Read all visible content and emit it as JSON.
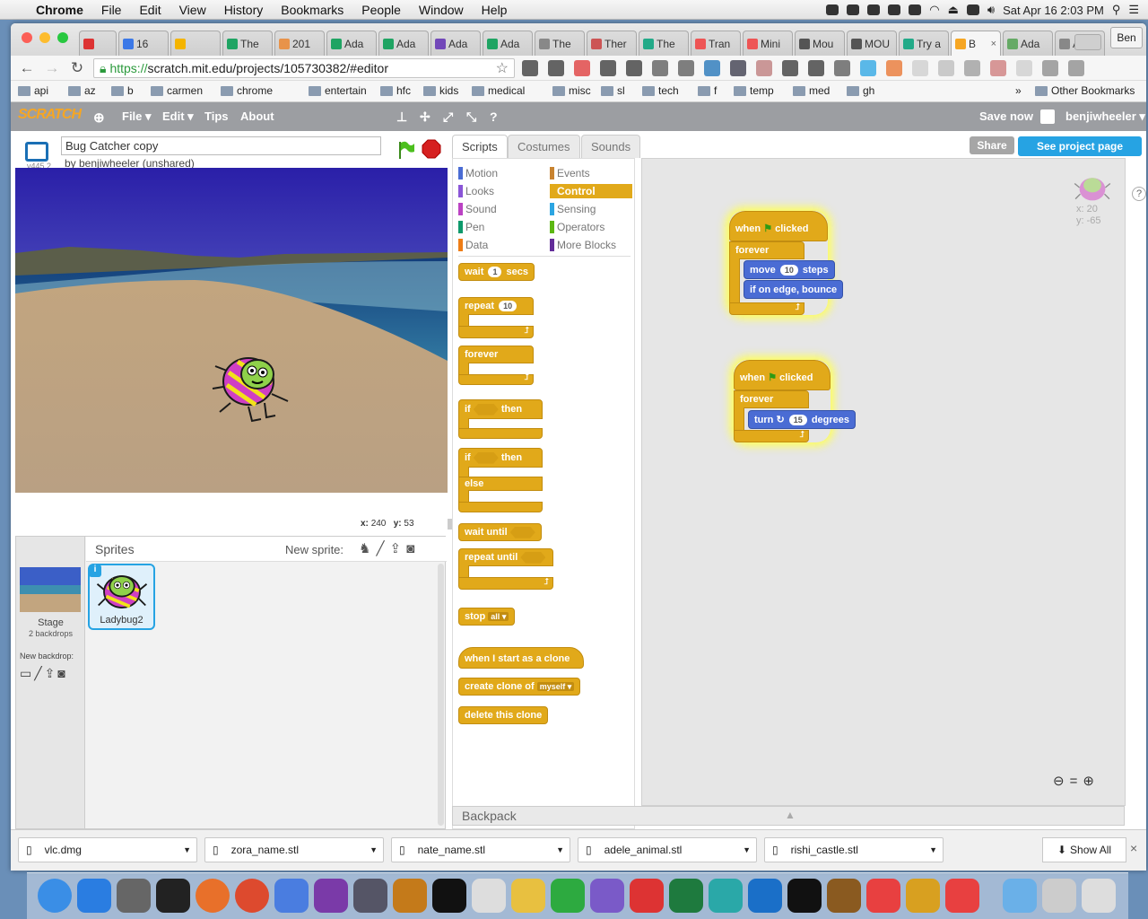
{
  "menubar": {
    "app": "Chrome",
    "items": [
      "File",
      "Edit",
      "View",
      "History",
      "Bookmarks",
      "People",
      "Window",
      "Help"
    ],
    "clock": "Sat Apr 16  2:03 PM"
  },
  "browser": {
    "tabs": [
      {
        "label": "",
        "icon": "gmail-icon",
        "color": "#d33"
      },
      {
        "label": "16",
        "icon": "calendar-icon",
        "color": "#3b78e7"
      },
      {
        "label": "",
        "icon": "drive-icon",
        "color": "#f4b400"
      },
      {
        "label": "The",
        "icon": "sheets-icon",
        "color": "#1fa463"
      },
      {
        "label": "201",
        "icon": "e-icon",
        "color": "#e8934a"
      },
      {
        "label": "Ada",
        "icon": "sheets-icon",
        "color": "#1fa463"
      },
      {
        "label": "Ada",
        "icon": "sheets-icon",
        "color": "#1fa463"
      },
      {
        "label": "Ada",
        "icon": "forms-icon",
        "color": "#7248b9"
      },
      {
        "label": "Ada",
        "icon": "sheets-icon",
        "color": "#1fa463"
      },
      {
        "label": "The",
        "icon": "page-icon",
        "color": "#888"
      },
      {
        "label": "Ther",
        "icon": "tree-icon",
        "color": "#c55"
      },
      {
        "label": "The",
        "icon": "medium-icon",
        "color": "#2a8"
      },
      {
        "label": "Tran",
        "icon": "pen-icon",
        "color": "#e55"
      },
      {
        "label": "Mini",
        "icon": "pen-icon",
        "color": "#e55"
      },
      {
        "label": "Mou",
        "icon": "page-icon",
        "color": "#555"
      },
      {
        "label": "MOU",
        "icon": "page-icon",
        "color": "#555"
      },
      {
        "label": "Try a",
        "icon": "medium-icon",
        "color": "#2a8"
      },
      {
        "label": "B",
        "icon": "scratch-icon",
        "color": "#f6a623",
        "active": true
      },
      {
        "label": "Ada",
        "icon": "link-icon",
        "color": "#6a6"
      },
      {
        "label": "Ada",
        "icon": "page-icon",
        "color": "#888"
      }
    ],
    "profile": "Ben",
    "url_scheme": "https://",
    "url_rest": "scratch.mit.edu/projects/105730382/#editor"
  },
  "bookmarks": [
    "api",
    "az",
    "b",
    "carmen",
    "chrome",
    "entertain",
    "hfc",
    "kids",
    "medical",
    "misc",
    "sl",
    "tech",
    "f",
    "temp",
    "med",
    "gh"
  ],
  "bookmarks_more": "»",
  "other_bookmarks": "Other Bookmarks",
  "scratch": {
    "logo": "SCRATCH",
    "nav": [
      "File ▾",
      "Edit ▾",
      "Tips",
      "About"
    ],
    "save_now": "Save now",
    "username": "benjiwheeler ▾",
    "project_title": "Bug Catcher copy",
    "byline": "by benjiwheeler (unshared)",
    "version": "v445.2",
    "share": "Share",
    "see_project": "See project page",
    "stage_x_label": "x:",
    "stage_x": "240",
    "stage_y_label": "y:",
    "stage_y": "53",
    "sprites_label": "Sprites",
    "new_sprite": "New sprite:",
    "stage_label": "Stage",
    "backdrops": "2 backdrops",
    "new_backdrop": "New backdrop:",
    "sprite_name": "Ladybug2",
    "tabs": [
      "Scripts",
      "Costumes",
      "Sounds"
    ],
    "categories_left": [
      {
        "name": "Motion",
        "color": "#4a6cd4"
      },
      {
        "name": "Looks",
        "color": "#8a55d7"
      },
      {
        "name": "Sound",
        "color": "#bb42c3"
      },
      {
        "name": "Pen",
        "color": "#0e9a6c"
      },
      {
        "name": "Data",
        "color": "#ee7d16"
      }
    ],
    "categories_right": [
      {
        "name": "Events",
        "color": "#c88330"
      },
      {
        "name": "Control",
        "color": "#e1a91a",
        "selected": true
      },
      {
        "name": "Sensing",
        "color": "#2ca5e2"
      },
      {
        "name": "Operators",
        "color": "#5cb712"
      },
      {
        "name": "More Blocks",
        "color": "#632d99"
      }
    ],
    "palette": {
      "wait": "wait",
      "wait_val": "1",
      "wait_unit": "secs",
      "repeat": "repeat",
      "repeat_val": "10",
      "forever": "forever",
      "if": "if",
      "then": "then",
      "if2": "if",
      "then2": "then",
      "else": "else",
      "wait_until": "wait  until",
      "repeat_until": "repeat  until",
      "stop": "stop",
      "stop_opt": "all",
      "clone_start": "when I start as a clone",
      "create_clone": "create clone of",
      "create_clone_opt": "myself",
      "delete_clone": "delete this clone"
    },
    "script1": {
      "when": "when",
      "clicked": "clicked",
      "forever": "forever",
      "move": "move",
      "move_val": "10",
      "steps": "steps",
      "bounce": "if on edge, bounce"
    },
    "script2": {
      "when": "when",
      "clicked": "clicked",
      "forever": "forever",
      "turn": "turn",
      "turn_val": "15",
      "degrees": "degrees"
    },
    "sprite_x": "x: 20",
    "sprite_y": "y: -65",
    "backpack": "Backpack"
  },
  "downloads": [
    "vlc.dmg",
    "zora_name.stl",
    "nate_name.stl",
    "adele_animal.stl",
    "rishi_castle.stl"
  ],
  "show_all": "Show All"
}
